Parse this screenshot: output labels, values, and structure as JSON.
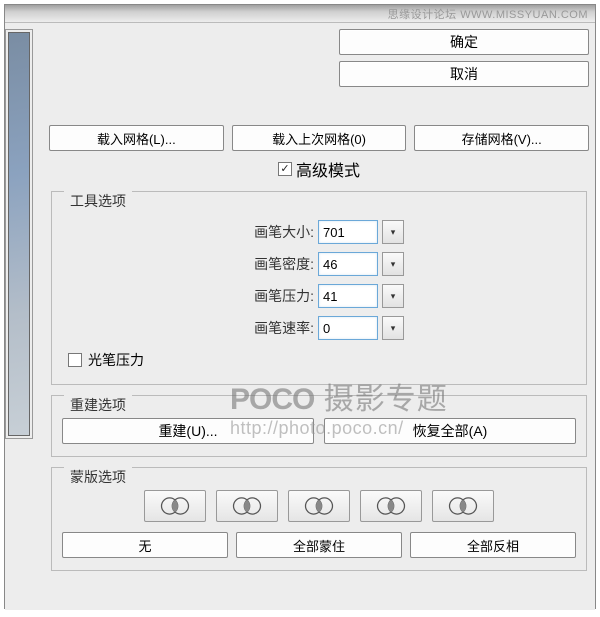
{
  "watermark_top": {
    "cn": "思缘设计论坛",
    "en": "WWW.MISSYUAN.COM"
  },
  "watermark_center": {
    "brand": "POCO",
    "title": "摄影专题",
    "url": "http://photo.poco.cn/"
  },
  "buttons": {
    "ok": "确定",
    "cancel": "取消",
    "load_mesh": "载入网格(L)...",
    "load_last_mesh": "载入上次网格(0)",
    "save_mesh": "存储网格(V)..."
  },
  "adv_mode": {
    "checked": true,
    "label": "高级模式"
  },
  "tool_options": {
    "legend": "工具选项",
    "brush_size": {
      "label": "画笔大小:",
      "value": "701"
    },
    "brush_density": {
      "label": "画笔密度:",
      "value": "46"
    },
    "brush_pressure": {
      "label": "画笔压力:",
      "value": "41"
    },
    "brush_rate": {
      "label": "画笔速率:",
      "value": "0"
    },
    "stylus": {
      "checked": false,
      "label": "光笔压力"
    }
  },
  "reconstruct": {
    "legend": "重建选项",
    "reconstruct_btn": "重建(U)...",
    "restore_all_btn": "恢复全部(A)"
  },
  "mask": {
    "legend": "蒙版选项",
    "none": "无",
    "mask_all": "全部蒙住",
    "invert_all": "全部反相"
  }
}
